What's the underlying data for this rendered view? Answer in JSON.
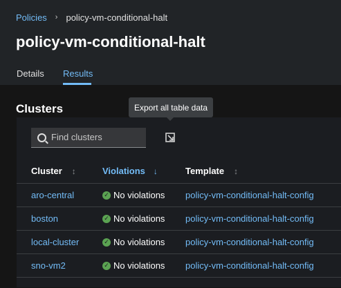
{
  "breadcrumb": {
    "parent": "Policies",
    "separator": "›",
    "current": "policy-vm-conditional-halt"
  },
  "page_title": "policy-vm-conditional-halt",
  "tabs": [
    {
      "label": "Details"
    },
    {
      "label": "Results"
    }
  ],
  "active_tab": "Results",
  "section_title": "Clusters",
  "tooltip": "Export all table data",
  "search": {
    "placeholder": "Find clusters",
    "value": ""
  },
  "table": {
    "columns": [
      {
        "label": "Cluster",
        "sort": "none"
      },
      {
        "label": "Violations",
        "sort": "descending"
      },
      {
        "label": "Template",
        "sort": "none"
      }
    ],
    "rows": [
      {
        "cluster": "aro-central",
        "violations": "No violations",
        "template": "policy-vm-conditional-halt-config"
      },
      {
        "cluster": "boston",
        "violations": "No violations",
        "template": "policy-vm-conditional-halt-config"
      },
      {
        "cluster": "local-cluster",
        "violations": "No violations",
        "template": "policy-vm-conditional-halt-config"
      },
      {
        "cluster": "sno-vm2",
        "violations": "No violations",
        "template": "policy-vm-conditional-halt-config"
      },
      {
        "cluster": "",
        "violations": "",
        "template": ""
      }
    ]
  },
  "colors": {
    "link": "#73bcf7",
    "success": "#5ba352",
    "background": "#151515"
  },
  "icons": {
    "breadcrumb_separator": "chevron-right-icon",
    "search": "search-icon",
    "export": "export-icon",
    "status": "check-circle-icon"
  }
}
